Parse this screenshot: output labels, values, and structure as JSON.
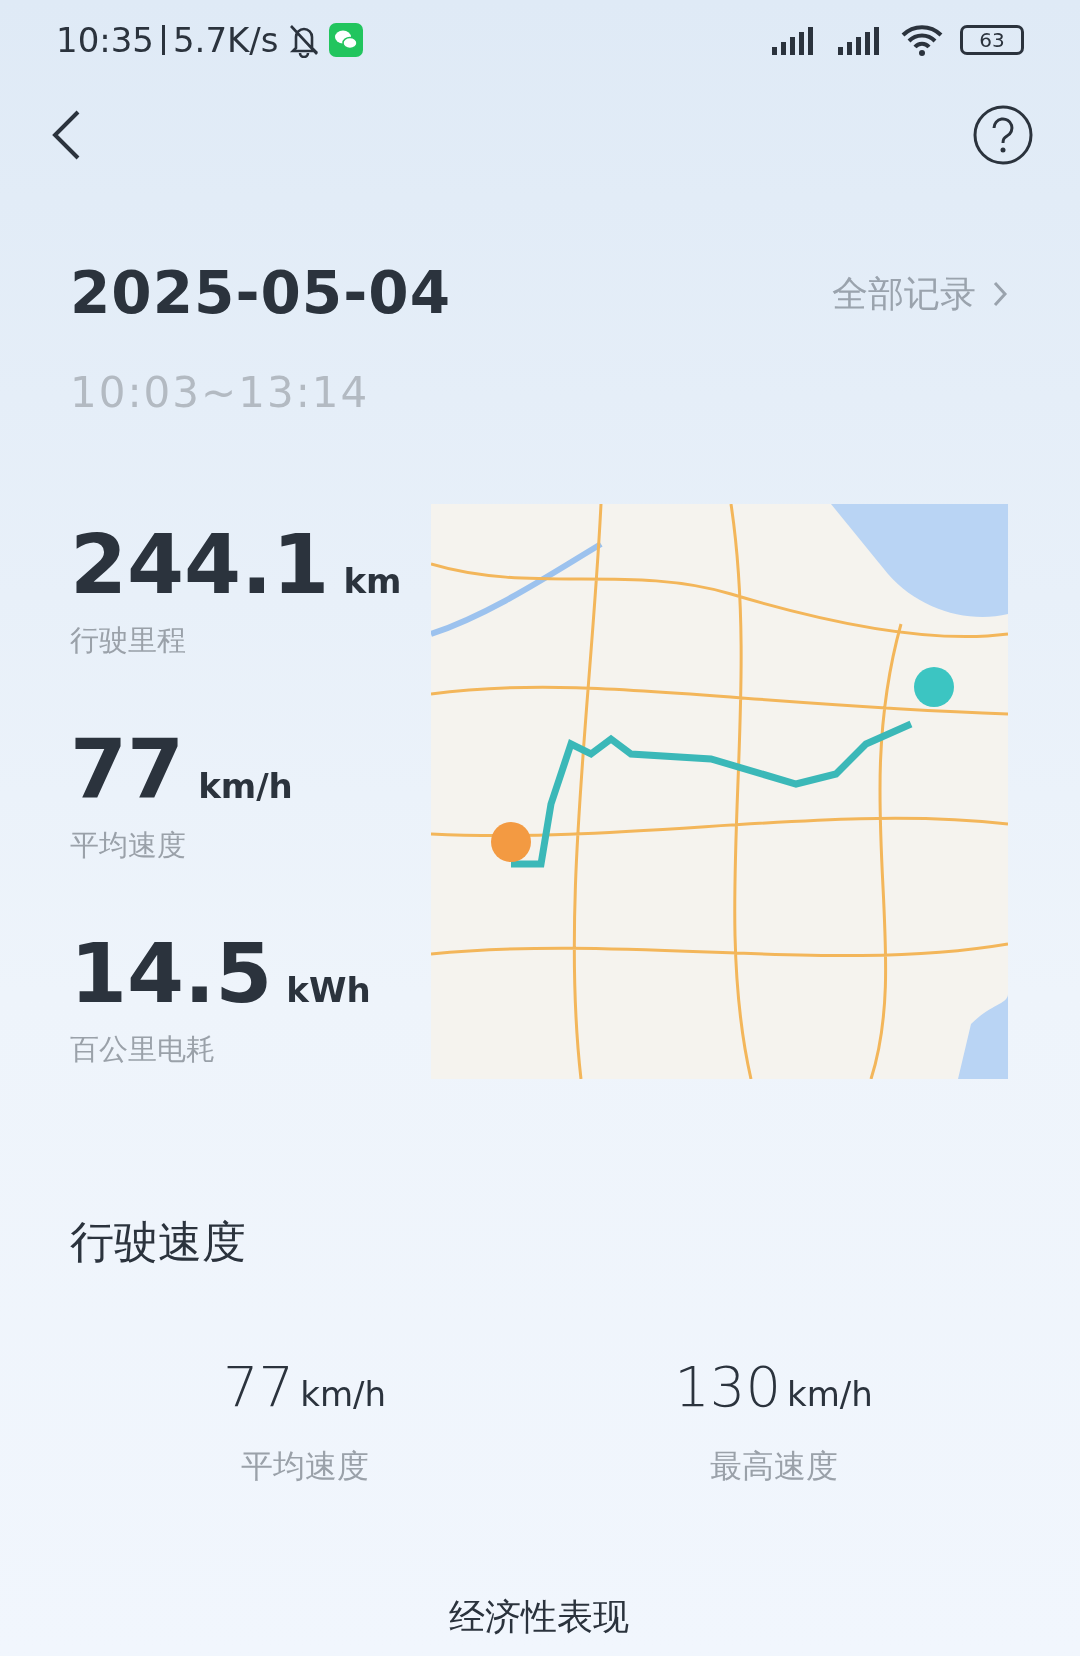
{
  "status_bar": {
    "time": "10:35",
    "speed": "5.7K/s",
    "battery": "63"
  },
  "header": {
    "date": "2025-05-04",
    "all_records": "全部记录",
    "time_range": "10:03~13:14"
  },
  "stats": [
    {
      "value": "244.1",
      "unit": "km",
      "label": "行驶里程"
    },
    {
      "value": "77",
      "unit": "km/h",
      "label": "平均速度"
    },
    {
      "value": "14.5",
      "unit": "kWh",
      "label": "百公里电耗"
    }
  ],
  "speed_section": {
    "title": "行驶速度",
    "items": [
      {
        "value": "77",
        "unit": "km/h",
        "label": "平均速度"
      },
      {
        "value": "130",
        "unit": "km/h",
        "label": "最高速度"
      }
    ]
  },
  "next_section": {
    "title": "经济性表现"
  }
}
